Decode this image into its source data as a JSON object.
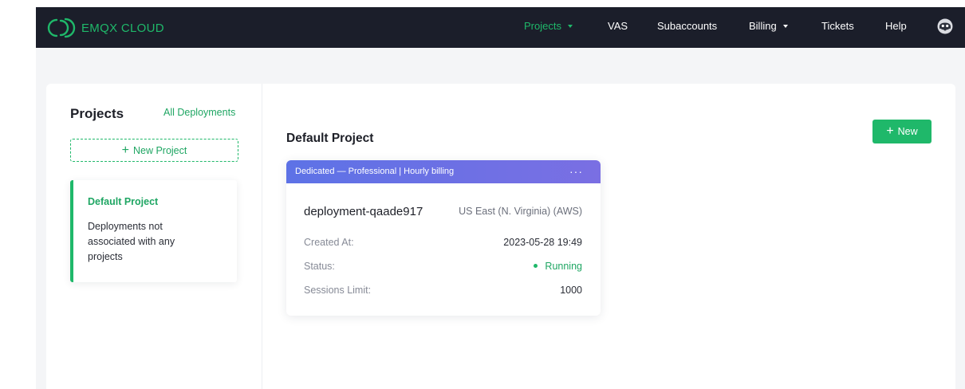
{
  "brand": {
    "name": "EMQX CLOUD",
    "accent": "#1fb86a"
  },
  "nav": {
    "items": [
      {
        "label": "Projects",
        "dropdown": true,
        "active": true
      },
      {
        "label": "VAS"
      },
      {
        "label": "Subaccounts"
      },
      {
        "label": "Billing",
        "dropdown": true
      },
      {
        "label": "Tickets"
      },
      {
        "label": "Help"
      }
    ],
    "avatar_icon": "user-avatar-icon"
  },
  "sidebar": {
    "title": "Projects",
    "all_link": "All Deployments",
    "new_project_label": "New Project",
    "projects": [
      {
        "name": "Default Project",
        "description": "Deployments not associated with any projects",
        "selected": true
      }
    ]
  },
  "main": {
    "title": "Default Project",
    "new_button_label": "New",
    "deployments": [
      {
        "header": "Dedicated — Professional | Hourly billing",
        "name": "deployment-qaade917",
        "region": "US East (N. Virginia) (AWS)",
        "created_label": "Created At:",
        "created_value": "2023-05-28 19:49",
        "status_label": "Status:",
        "status_value": "Running",
        "sessions_label": "Sessions Limit:",
        "sessions_value": "1000"
      }
    ]
  },
  "colors": {
    "navbar": "#1b1e2a",
    "header_gradient": [
      "#5d72e6",
      "#7a6fe3"
    ],
    "status_running": "#1fb86a"
  }
}
